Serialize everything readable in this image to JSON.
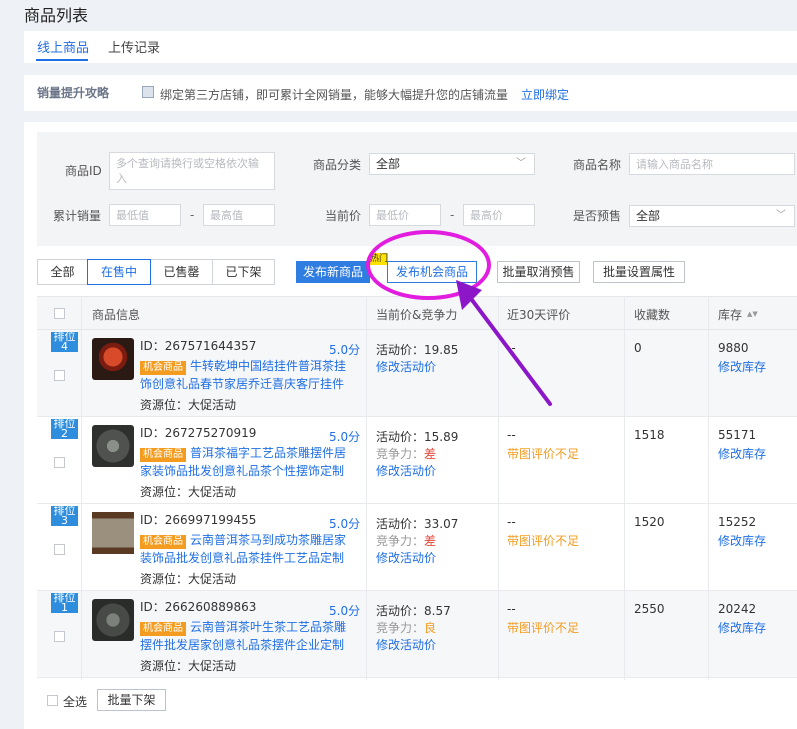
{
  "page": {
    "title": "商品列表"
  },
  "tabs": [
    {
      "label": "线上商品",
      "active": true
    },
    {
      "label": "上传记录",
      "active": false
    }
  ],
  "promo": {
    "title": "销量提升攻略",
    "text": "绑定第三方店铺，即可累计全网销量，能够大幅提升您的店铺流量",
    "link": "立即绑定"
  },
  "filters": {
    "product_id": {
      "label": "商品ID",
      "placeholder": "多个查询请换行或空格依次输入"
    },
    "category": {
      "label": "商品分类",
      "value": "全部"
    },
    "product_name": {
      "label": "商品名称",
      "placeholder": "请输入商品名称"
    },
    "total_sales": {
      "label": "累计销量",
      "min_placeholder": "最低值",
      "max_placeholder": "最高值"
    },
    "current_price": {
      "label": "当前价",
      "min_placeholder": "最低价",
      "max_placeholder": "最高价"
    },
    "presale": {
      "label": "是否预售",
      "value": "全部"
    },
    "range_sep": "-"
  },
  "status_tabs": [
    {
      "label": "全部",
      "active": false
    },
    {
      "label": "在售中",
      "active": true
    },
    {
      "label": "已售罄",
      "active": false
    },
    {
      "label": "已下架",
      "active": false
    }
  ],
  "actions": {
    "publish_new": "发布新商品",
    "hot_tag": "热门",
    "publish_opportunity": "发布机会商品",
    "cancel_presale": "批量取消预售",
    "set_attributes": "批量设置属性"
  },
  "table": {
    "headers": {
      "info": "商品信息",
      "price": "当前价&竞争力",
      "reviews": "近30天评价",
      "favorites": "收藏数",
      "stock": "库存",
      "stock_sort": "▲▼"
    },
    "rows": [
      {
        "rank": "排位4",
        "id": "ID：267571644357",
        "score": "5.0分",
        "tag": "机会商品",
        "title": "牛转乾坤中国结挂件普洱茶挂饰创意礼品春节家居乔迁喜庆客厅挂件",
        "source": "资源位：大促活动",
        "price": "活动价：19.85",
        "competition_label": "",
        "competition_value": "",
        "edit_price": "修改活动价",
        "review": "--",
        "review_note": "",
        "favorites": "0",
        "stock": "9880",
        "edit_stock": "修改库存"
      },
      {
        "rank": "排位2",
        "id": "ID：267275270919",
        "score": "5.0分",
        "tag": "机会商品",
        "title": "普洱茶福字工艺品茶雕摆件居家装饰品批发创意礼品茶个性摆饰定制",
        "source": "资源位：大促活动",
        "price": "活动价：15.89",
        "competition_label": "竞争力：",
        "competition_value": "差",
        "edit_price": "修改活动价",
        "review": "--",
        "review_note": "带图评价不足",
        "favorites": "1518",
        "stock": "55171",
        "edit_stock": "修改库存"
      },
      {
        "rank": "排位3",
        "id": "ID：266997199455",
        "score": "5.0分",
        "tag": "机会商品",
        "title": "云南普洱茶马到成功茶雕居家装饰品批发创意礼品茶挂件工艺品定制",
        "source": "资源位：大促活动",
        "price": "活动价：33.07",
        "competition_label": "竞争力：",
        "competition_value": "差",
        "edit_price": "修改活动价",
        "review": "--",
        "review_note": "带图评价不足",
        "favorites": "1520",
        "stock": "15252",
        "edit_stock": "修改库存"
      },
      {
        "rank": "排位1",
        "id": "ID：266260889863",
        "score": "5.0分",
        "tag": "机会商品",
        "title": "云南普洱茶叶生茶工艺品茶雕摆件批发居家创意礼品茶摆件企业定制",
        "source": "资源位：大促活动",
        "price": "活动价：8.57",
        "competition_label": "竞争力：",
        "competition_value": "良",
        "edit_price": "修改活动价",
        "review": "--",
        "review_note": "带图评价不足",
        "favorites": "2550",
        "stock": "20242",
        "edit_stock": "修改库存"
      }
    ]
  },
  "footer": {
    "select_all": "全选",
    "batch_delist": "批量下架"
  },
  "colors": {
    "accent": "#1f6fe5",
    "annotation": "#e21de0",
    "arrow": "#8b17c9",
    "tag": "#f39c1f"
  }
}
